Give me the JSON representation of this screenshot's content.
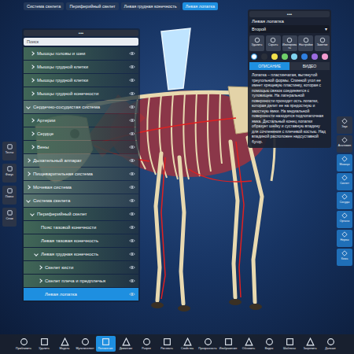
{
  "breadcrumbs": [
    {
      "label": "Система скелета",
      "selected": false
    },
    {
      "label": "Периферийный скелет",
      "selected": false
    },
    {
      "label": "Левая грудная конечность",
      "selected": false
    },
    {
      "label": "Левая лопатка",
      "selected": true
    }
  ],
  "left_toolbar": [
    {
      "label": "Тесты"
    },
    {
      "label": "Фокус"
    },
    {
      "label": "Поиск"
    },
    {
      "label": "Слои"
    }
  ],
  "tree": {
    "header": "•••",
    "search_placeholder": "Поиск",
    "items": [
      {
        "label": "Мышцы головы и шеи",
        "level": 1,
        "expandable": true,
        "expanded": false,
        "selected": false
      },
      {
        "label": "Мышцы грудной клетки",
        "level": 1,
        "expandable": true,
        "expanded": false,
        "selected": false
      },
      {
        "label": "Мышцы грудной клетки",
        "level": 1,
        "expandable": true,
        "expanded": false,
        "selected": false
      },
      {
        "label": "Мышцы грудной конечности",
        "level": 1,
        "expandable": true,
        "expanded": false,
        "selected": false
      },
      {
        "label": "Сердечно-сосудистая система",
        "level": 0,
        "expandable": true,
        "expanded": true,
        "selected": false
      },
      {
        "label": "Артерии",
        "level": 1,
        "expandable": true,
        "expanded": false,
        "selected": false
      },
      {
        "label": "Сердце",
        "level": 1,
        "expandable": true,
        "expanded": false,
        "selected": false
      },
      {
        "label": "Вены",
        "level": 1,
        "expandable": true,
        "expanded": false,
        "selected": false
      },
      {
        "label": "Дыхательный аппарат",
        "level": 0,
        "expandable": true,
        "expanded": false,
        "selected": false
      },
      {
        "label": "Пищеварительная система",
        "level": 0,
        "expandable": true,
        "expanded": false,
        "selected": false
      },
      {
        "label": "Мочевая система",
        "level": 0,
        "expandable": true,
        "expanded": false,
        "selected": false
      },
      {
        "label": "Система скелета",
        "level": 0,
        "expandable": true,
        "expanded": true,
        "selected": false
      },
      {
        "label": "Периферийный скелет",
        "level": 1,
        "expandable": true,
        "expanded": true,
        "selected": false
      },
      {
        "label": "Пояс тазовой конечности",
        "level": 2,
        "expandable": false,
        "expanded": false,
        "selected": false
      },
      {
        "label": "Левая тазовая конечность",
        "level": 2,
        "expandable": false,
        "expanded": false,
        "selected": false
      },
      {
        "label": "Левая грудная конечность",
        "level": 2,
        "expandable": true,
        "expanded": true,
        "selected": false
      },
      {
        "label": "Скелет кисти",
        "level": 3,
        "expandable": true,
        "expanded": false,
        "selected": false
      },
      {
        "label": "Скелет плеча и предплечья",
        "level": 3,
        "expandable": true,
        "expanded": false,
        "selected": false
      },
      {
        "label": "Левая лопатка",
        "level": 3,
        "expandable": false,
        "expanded": false,
        "selected": true
      }
    ]
  },
  "info_panel": {
    "header": "•••",
    "title": "Левая лопатка",
    "dropdown": "Второй",
    "dropdown_arrow": "▾",
    "tools": [
      "Удалить",
      "Скрыть",
      "Изолировать",
      "Настройки",
      "Заметки"
    ],
    "colors": [
      {
        "color": "#ffffff",
        "selected": true
      },
      {
        "color": "#2a2f3a",
        "selected": false
      },
      {
        "color": "#f2e14b",
        "selected": false
      },
      {
        "color": "#6fd06a",
        "selected": false
      },
      {
        "color": "#7fd3f0",
        "selected": false
      },
      {
        "color": "#2f7fe0",
        "selected": false
      },
      {
        "color": "#9b6be0",
        "selected": false
      },
      {
        "color": "#f29bd0",
        "selected": false
      }
    ],
    "tabs": [
      {
        "label": "ОПИСАНИЕ",
        "selected": true
      },
      {
        "label": "ВИДЕО",
        "selected": false
      }
    ],
    "description": "Лопатка – пластинчатая, вытянутой треугольной формы. Спинной угол ее имеет хрящевую пластинку, которая с помощью связок соединяется с туловищем. На латеральной поверхности проходит ость лопатки, которая делит ее на предостную и заостную ямки. На медиальной поверхности находится подлопаточная ямка. Дистальный конец лопатки образует шейку и суставную впадину для сочленения с плечевой костью. Над впадиной расположен надсуставной бугор."
  },
  "right_toolbar": [
    {
      "label": "Звук",
      "active": false
    },
    {
      "label": "Анатомия",
      "active": false
    },
    {
      "label": "Мышцы",
      "active": true
    },
    {
      "label": "Скелет",
      "active": true
    },
    {
      "label": "Сосуды",
      "active": true
    },
    {
      "label": "Органы",
      "active": true
    },
    {
      "label": "Нервы",
      "active": true
    },
    {
      "label": "Кожа",
      "active": true
    }
  ],
  "bottom_toolbar": [
    {
      "label": "Приблизить",
      "selected": false
    },
    {
      "label": "Удалить",
      "selected": false
    },
    {
      "label": "Модель",
      "selected": false
    },
    {
      "label": "Мультиселект",
      "selected": false
    },
    {
      "label": "Положение",
      "selected": true
    },
    {
      "label": "Движение",
      "selected": false
    },
    {
      "label": "Разрез",
      "selected": false
    },
    {
      "label": "Рисовать",
      "selected": false
    },
    {
      "label": "Свойства",
      "selected": false
    },
    {
      "label": "Прозрачность",
      "selected": false
    },
    {
      "label": "Изображения",
      "selected": false
    },
    {
      "label": "Обновить",
      "selected": false
    },
    {
      "label": "Видео",
      "selected": false
    },
    {
      "label": "Шаблоны",
      "selected": false
    },
    {
      "label": "Закрепить",
      "selected": false
    },
    {
      "label": "Дальше",
      "selected": false
    }
  ]
}
